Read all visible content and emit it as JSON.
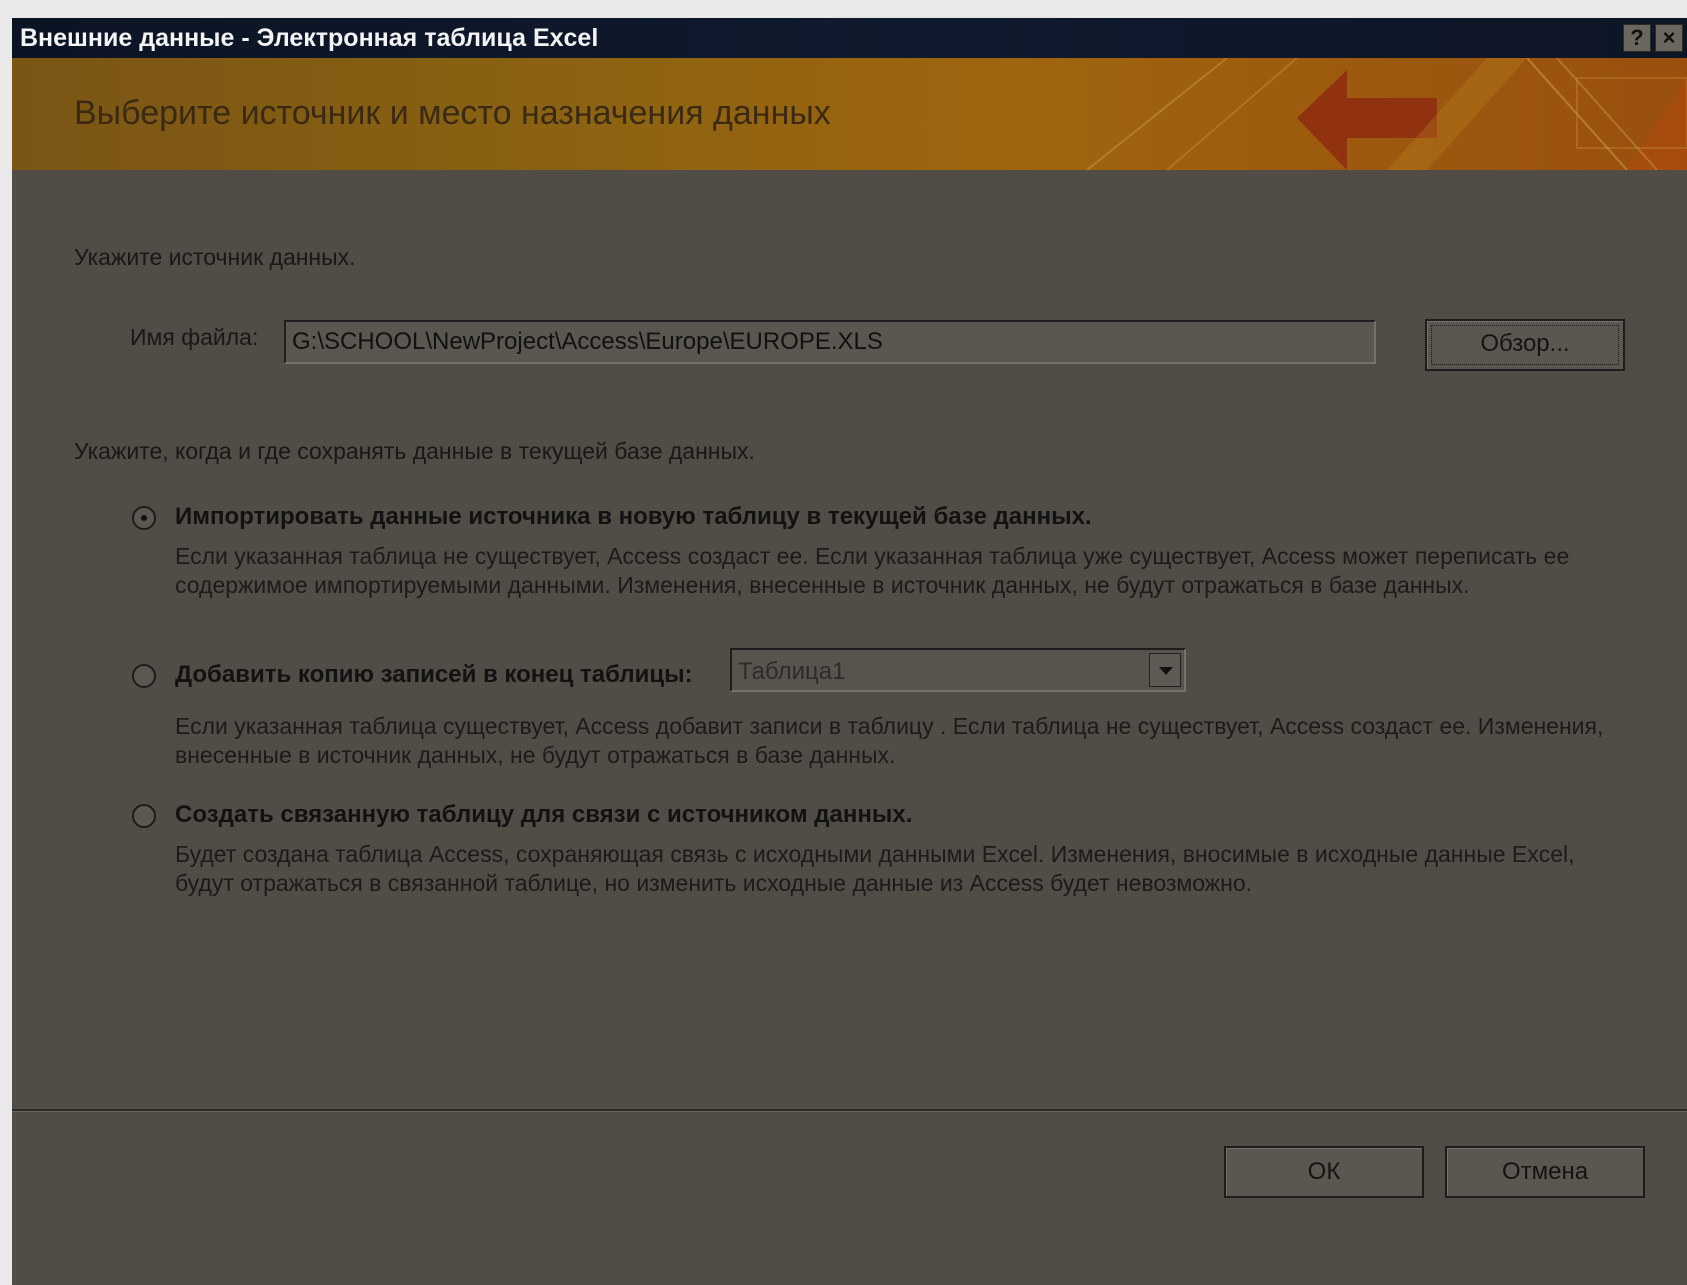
{
  "window": {
    "title": "Внешние данные - Электронная таблица Excel",
    "help_glyph": "?",
    "close_glyph": "×"
  },
  "banner": {
    "title": "Выберите источник и место назначения данных"
  },
  "source": {
    "prompt": "Укажите источник данных.",
    "file_label": "Имя файла:",
    "file_value": "G:\\SCHOOL\\NewProject\\Access\\Europe\\EUROPE.XLS",
    "browse_label": "Обзор..."
  },
  "destination": {
    "prompt": "Укажите, когда и где сохранять данные в текущей базе данных.",
    "options": [
      {
        "label": "Импортировать данные источника в новую таблицу в текущей базе данных.",
        "selected": true,
        "description": "Если указанная таблица не существует, Access создаст ее. Если указанная таблица уже существует, Access может переписать ее содержимое импортируемыми данными. Изменения, внесенные в источник данных, не будут отражаться в базе данных."
      },
      {
        "label": "Добавить копию записей в конец таблицы:",
        "selected": false,
        "combo_value": "Таблица1",
        "description": "Если указанная таблица существует, Access добавит записи в таблицу . Если таблица не существует, Access создаст ее. Изменения, внесенные в источник данных, не будут отражаться в базе данных."
      },
      {
        "label": "Создать связанную таблицу для связи с источником данных.",
        "selected": false,
        "description": "Будет создана таблица Access, сохраняющая связь с исходными данными Excel. Изменения, вносимые в исходные данные Excel, будут отражаться в связанной таблице, но изменить исходные данные из Access будет невозможно."
      }
    ]
  },
  "footer": {
    "ok_label": "ОК",
    "cancel_label": "Отмена"
  }
}
